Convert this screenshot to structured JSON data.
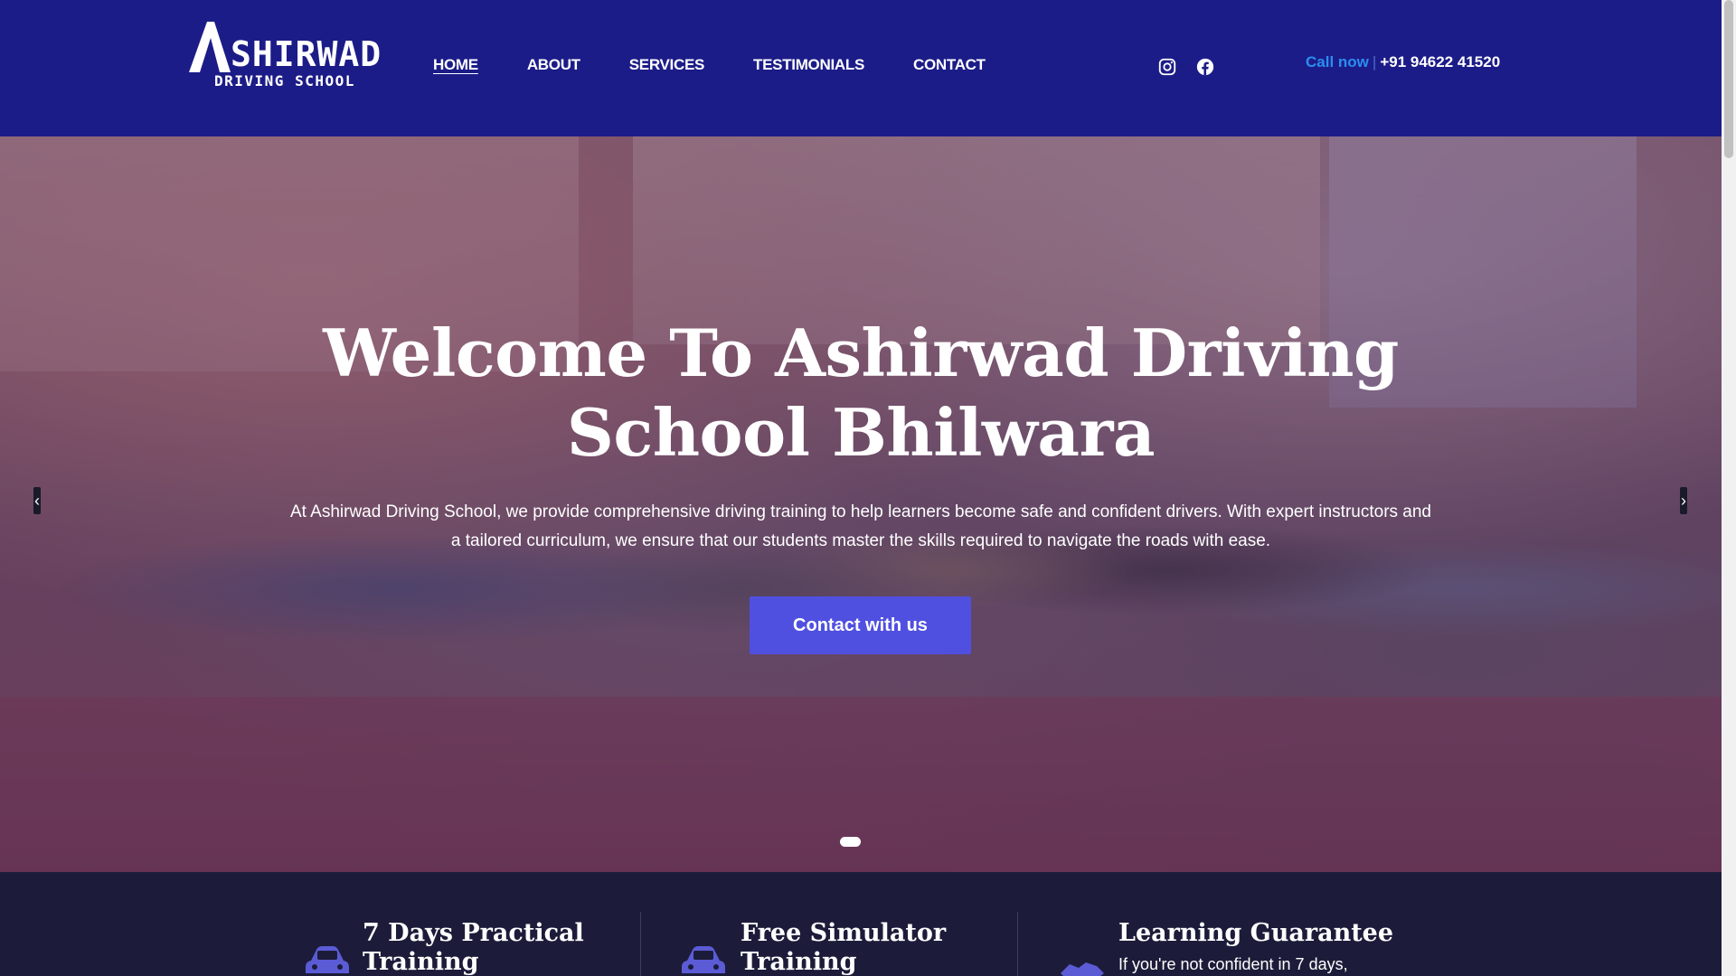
{
  "brand": {
    "logo_initial": "A",
    "logo_word": "SHIRWAD",
    "logo_sub": "DRIVING SCHOOL",
    "header_color": "#1c1c88"
  },
  "nav": {
    "items": [
      {
        "label": "HOME",
        "active": true
      },
      {
        "label": "ABOUT",
        "active": false
      },
      {
        "label": "SERVICES",
        "active": false
      },
      {
        "label": "TESTIMONIALS",
        "active": false
      },
      {
        "label": "CONTACT",
        "active": false
      }
    ]
  },
  "social": {
    "icons": [
      "instagram-icon",
      "facebook-icon"
    ]
  },
  "call": {
    "label": "Call now",
    "separator": "|",
    "number": "+91 94622 41520",
    "label_color": "#2b8df0"
  },
  "hero": {
    "title": "Welcome To Ashirwad Driving School Bhilwara",
    "description": "At Ashirwad Driving School, we provide comprehensive driving training to help learners become safe and confident drivers. With expert instructors and a tailored curriculum, we ensure that our students master the skills required to navigate the roads with ease.",
    "button_label": "Contact with us",
    "button_color": "#5050e0",
    "prev_arrow": "‹",
    "next_arrow": "›"
  },
  "features": [
    {
      "icon": "car-icon",
      "title_line1": "7 Days Practical",
      "title_line2": "Training",
      "text": ""
    },
    {
      "icon": "car-icon",
      "title_line1": "Free Simulator",
      "title_line2": "Training",
      "text": ""
    },
    {
      "icon": "handshake-icon",
      "title_line1": "Learning Guarantee",
      "title_line2": "",
      "text": "If you're not confident in 7 days,"
    }
  ]
}
